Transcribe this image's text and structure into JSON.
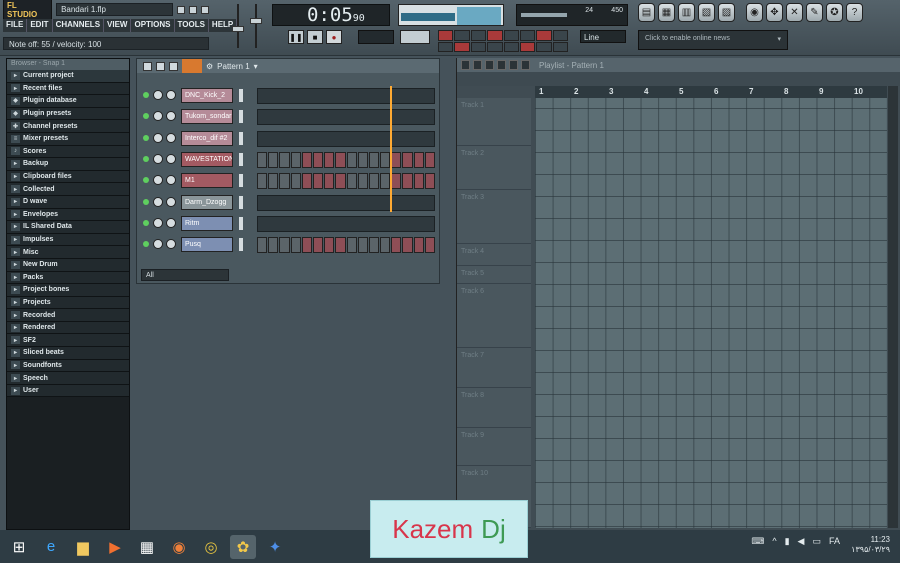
{
  "app": {
    "logo": "FL STUDIO",
    "filename": "Bandari 1.flp"
  },
  "menu": [
    "FILE",
    "EDIT",
    "CHANNELS",
    "VIEW",
    "OPTIONS",
    "TOOLS",
    "HELP"
  ],
  "hint": "Note off: 55 / velocity: 100",
  "time_display": {
    "main": "0:05",
    "sub": "90"
  },
  "cpu": {
    "left": "24",
    "right": "450"
  },
  "snap": "Line",
  "news": "Click to enable online news",
  "browser": {
    "header": "Browser - Snap 1",
    "items": [
      {
        "label": "Current project",
        "icon": "folder-icon"
      },
      {
        "label": "Recent files",
        "icon": "folder-icon"
      },
      {
        "label": "Plugin database",
        "icon": "plugin-icon"
      },
      {
        "label": "Plugin presets",
        "icon": "plugin-icon"
      },
      {
        "label": "Channel presets",
        "icon": "channel-icon"
      },
      {
        "label": "Mixer presets",
        "icon": "mixer-icon"
      },
      {
        "label": "Scores",
        "icon": "note-icon"
      },
      {
        "label": "Backup",
        "icon": "folder-icon"
      },
      {
        "label": "Clipboard files",
        "icon": "folder-icon"
      },
      {
        "label": "Collected",
        "icon": "folder-icon"
      },
      {
        "label": "D wave",
        "icon": "folder-icon"
      },
      {
        "label": "Envelopes",
        "icon": "folder-icon"
      },
      {
        "label": "IL Shared Data",
        "icon": "folder-icon"
      },
      {
        "label": "Impulses",
        "icon": "folder-icon"
      },
      {
        "label": "Misc",
        "icon": "folder-icon"
      },
      {
        "label": "New Drum",
        "icon": "folder-icon"
      },
      {
        "label": "Packs",
        "icon": "folder-icon"
      },
      {
        "label": "Project bones",
        "icon": "folder-icon"
      },
      {
        "label": "Projects",
        "icon": "folder-icon"
      },
      {
        "label": "Recorded",
        "icon": "folder-icon"
      },
      {
        "label": "Rendered",
        "icon": "folder-icon"
      },
      {
        "label": "SF2",
        "icon": "folder-icon"
      },
      {
        "label": "Sliced beats",
        "icon": "folder-icon"
      },
      {
        "label": "Soundfonts",
        "icon": "folder-icon"
      },
      {
        "label": "Speech",
        "icon": "folder-icon"
      },
      {
        "label": "User",
        "icon": "folder-icon"
      }
    ]
  },
  "rack": {
    "title": "Pattern 1",
    "filter": "All",
    "channels": [
      {
        "name": "DNC_Kick_2",
        "color": "pink"
      },
      {
        "name": "Tukom_sondar",
        "color": "pink"
      },
      {
        "name": "Interco_dif #2",
        "color": "pink"
      },
      {
        "name": "WAVESTATION",
        "color": "red"
      },
      {
        "name": "M1",
        "color": "red"
      },
      {
        "name": "Darm_Dzogg",
        "color": "gray"
      },
      {
        "name": "Ritm",
        "color": "blue"
      },
      {
        "name": "Pusq",
        "color": "blue"
      }
    ]
  },
  "playlist": {
    "title": "Playlist - Pattern 1",
    "ruler": [
      "1",
      "2",
      "3",
      "4",
      "5",
      "6",
      "7",
      "8",
      "9",
      "10"
    ],
    "tracks": [
      "Track 1",
      "Track 2",
      "Track 3",
      "Track 4",
      "Track 5",
      "Track 6",
      "Track 7",
      "Track 8",
      "Track 9",
      "Track 10"
    ]
  },
  "taskbar": {
    "lang": "FA",
    "time": "11:23",
    "date": "۱۳۹۵/۰۳/۲۹"
  },
  "watermark": {
    "first": "Kazem",
    "second": "Dj"
  }
}
